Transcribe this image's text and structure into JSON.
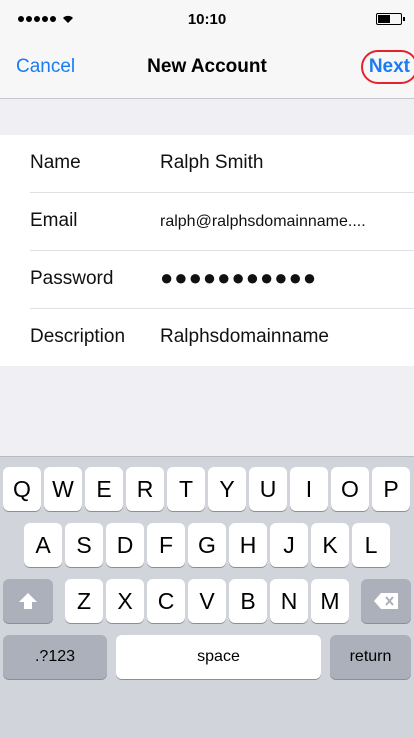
{
  "status_bar": {
    "time": "10:10"
  },
  "nav": {
    "cancel_label": "Cancel",
    "title": "New Account",
    "next_label": "Next"
  },
  "form": {
    "rows": [
      {
        "label": "Name",
        "value": "Ralph Smith"
      },
      {
        "label": "Email",
        "value": "ralph@ralphsdomainname...."
      },
      {
        "label": "Password",
        "value": "●●●●●●●●●●●"
      },
      {
        "label": "Description",
        "value": "Ralphsdomainname"
      }
    ]
  },
  "keyboard": {
    "row1": [
      "Q",
      "W",
      "E",
      "R",
      "T",
      "Y",
      "U",
      "I",
      "O",
      "P"
    ],
    "row2": [
      "A",
      "S",
      "D",
      "F",
      "G",
      "H",
      "J",
      "K",
      "L"
    ],
    "row3": [
      "Z",
      "X",
      "C",
      "V",
      "B",
      "N",
      "M"
    ],
    "numbers_label": ".?123",
    "space_label": "space",
    "return_label": "return"
  },
  "colors": {
    "accent": "#1a7bf2",
    "highlight_ring": "#e3232b",
    "keyboard_bg": "#d1d4db"
  }
}
